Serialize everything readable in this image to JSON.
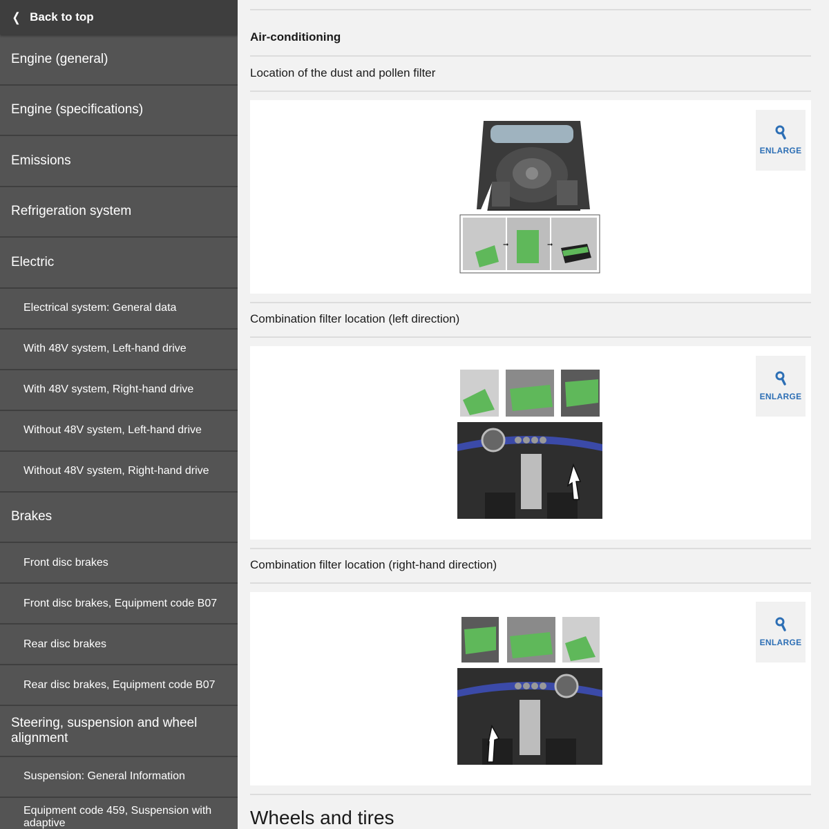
{
  "sidebar": {
    "back_to_top": "Back to top",
    "items": [
      {
        "label": "Engine (general)"
      },
      {
        "label": "Engine (specifications)"
      },
      {
        "label": "Emissions"
      },
      {
        "label": "Refrigeration system"
      },
      {
        "label": "Electric"
      },
      {
        "label": "Electrical system: General data"
      },
      {
        "label": "With 48V system, Left-hand drive"
      },
      {
        "label": "With 48V system, Right-hand drive"
      },
      {
        "label": "Without 48V system, Left-hand drive"
      },
      {
        "label": "Without 48V system, Right-hand drive"
      },
      {
        "label": "Brakes"
      },
      {
        "label": "Front disc brakes"
      },
      {
        "label": "Front disc brakes, Equipment code B07"
      },
      {
        "label": "Rear disc brakes"
      },
      {
        "label": "Rear disc brakes, Equipment code B07"
      },
      {
        "label": "Steering, suspension and wheel alignment"
      },
      {
        "label": "Suspension: General Information"
      },
      {
        "label": "Equipment code 459, Suspension with adaptive"
      }
    ]
  },
  "main": {
    "section_title": "Air-conditioning",
    "figures": [
      {
        "title": "Location of the dust and pollen filter",
        "enlarge_label": "ENLARGE"
      },
      {
        "title": "Combination filter location (left direction)",
        "enlarge_label": "ENLARGE"
      },
      {
        "title": "Combination filter location (right-hand direction)",
        "enlarge_label": "ENLARGE"
      }
    ],
    "next_section_title": "Wheels and tires"
  },
  "colors": {
    "sidebar_bg": "#545454",
    "sidebar_header_bg": "#3e3e3e",
    "accent_link": "#2d6fb5",
    "filter_green": "#5fb85a"
  },
  "icons": {
    "back": "chevron-left-icon",
    "enlarge": "magnifier-icon"
  }
}
